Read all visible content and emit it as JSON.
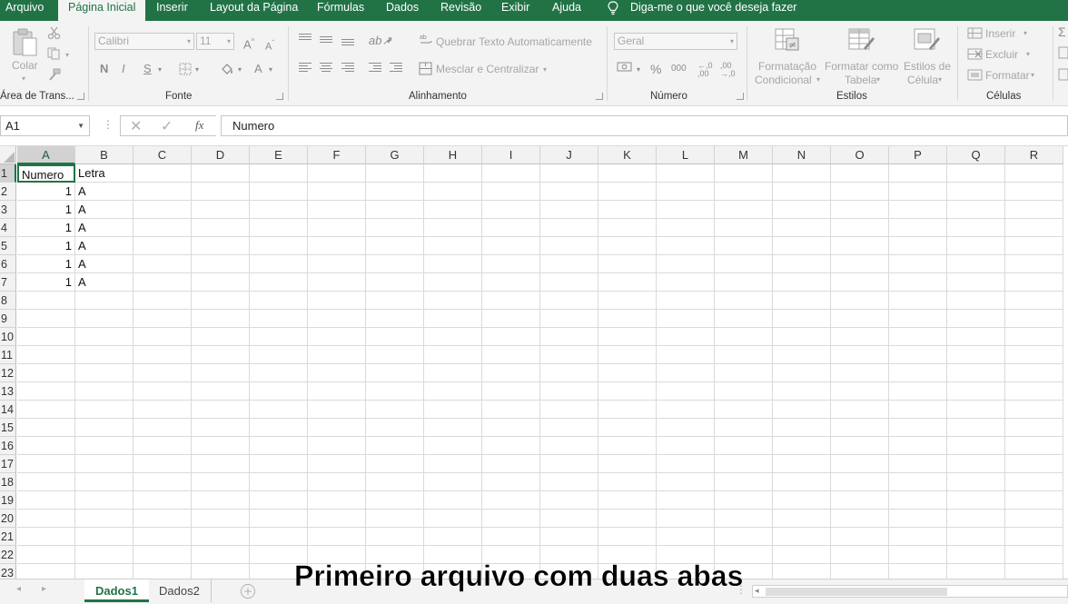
{
  "menu_tabs": [
    "Arquivo",
    "Página Inicial",
    "Inserir",
    "Layout da Página",
    "Fórmulas",
    "Dados",
    "Revisão",
    "Exibir",
    "Ajuda"
  ],
  "active_tab": "Página Inicial",
  "tell_me": "Diga-me o que você deseja fazer",
  "ribbon": {
    "clipboard": {
      "paste_label": "Colar",
      "group_label": "Área de Trans..."
    },
    "font": {
      "font_name": "Calibri",
      "font_size": "11",
      "bold": "N",
      "italic": "I",
      "underline": "S",
      "grow": "A",
      "shrink": "A",
      "color_a": "A",
      "group_label": "Fonte"
    },
    "alignment": {
      "wrap_text": "Quebrar Texto Automaticamente",
      "merge_center": "Mesclar e Centralizar",
      "group_label": "Alinhamento"
    },
    "number": {
      "format": "Geral",
      "percent": "%",
      "thousands": "000",
      "inc_dec": ",0 ,00",
      "dec_dec": ",00 ,0",
      "group_label": "Número"
    },
    "styles": {
      "conditional": "Formatação",
      "conditional2": "Condicional",
      "table": "Formatar como",
      "table2": "Tabela",
      "cell_styles": "Estilos de",
      "cell_styles2": "Célula",
      "group_label": "Estilos"
    },
    "cells": {
      "insert": "Inserir",
      "delete": "Excluir",
      "format": "Formatar",
      "group_label": "Células"
    }
  },
  "formula_bar": {
    "name_box": "A1",
    "fx": "fx",
    "formula": "Numero"
  },
  "columns": [
    "A",
    "B",
    "C",
    "D",
    "E",
    "F",
    "G",
    "H",
    "I",
    "J",
    "K",
    "L",
    "M",
    "N",
    "O",
    "P",
    "Q",
    "R"
  ],
  "rows": [
    "1",
    "2",
    "3",
    "4",
    "5",
    "6",
    "7",
    "8",
    "9",
    "10",
    "11",
    "12",
    "13",
    "14",
    "15",
    "16",
    "17",
    "18",
    "19",
    "20",
    "21",
    "22",
    "23"
  ],
  "cells": [
    {
      "A": "Numero",
      "B": "Letra"
    },
    {
      "A": "1",
      "B": "A"
    },
    {
      "A": "1",
      "B": "A"
    },
    {
      "A": "1",
      "B": "A"
    },
    {
      "A": "1",
      "B": "A"
    },
    {
      "A": "1",
      "B": "A"
    },
    {
      "A": "1",
      "B": "A"
    }
  ],
  "sheets": [
    "Dados1",
    "Dados2"
  ],
  "active_sheet": "Dados1",
  "caption": "Primeiro arquivo com duas abas",
  "colors": {
    "accent": "#217346",
    "ribbon_bg": "#f3f3f3"
  }
}
